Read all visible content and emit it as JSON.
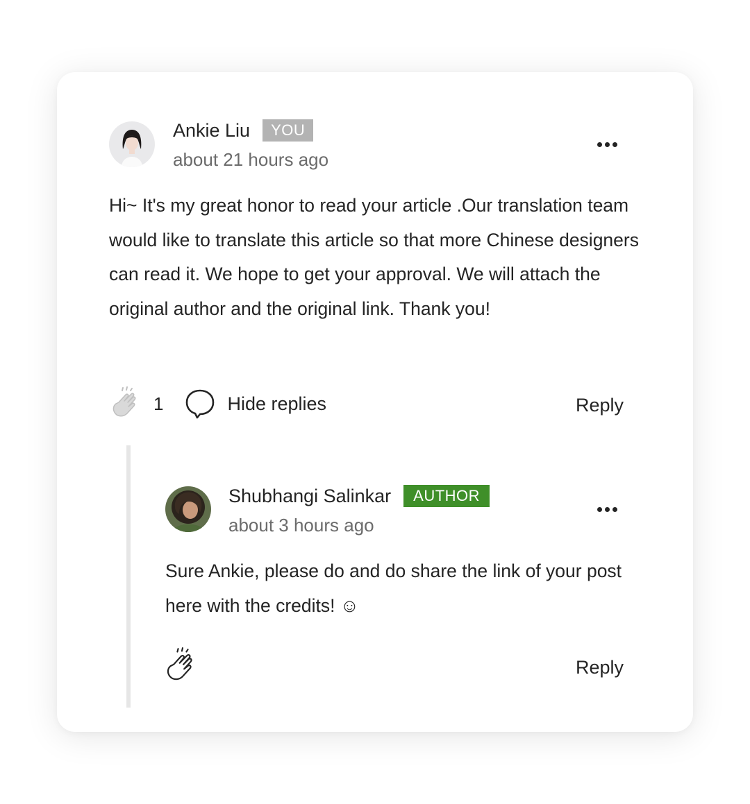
{
  "comments": [
    {
      "author": "Ankie Liu",
      "badge": "YOU",
      "timestamp": "about 21 hours ago",
      "avatar_icon": "person-avatar",
      "body": "Hi~ It's my great honor to read your article .Our translation team would like to translate this article so that more Chinese designers can read it. We hope to get your approval. We will attach the original author and the original link. Thank you!",
      "clap_count": "1",
      "hide_replies_label": "Hide replies",
      "reply_label": "Reply"
    }
  ],
  "replies": [
    {
      "author": "Shubhangi Salinkar",
      "badge": "AUTHOR",
      "timestamp": "about 3 hours ago",
      "avatar_icon": "person-avatar",
      "body": "Sure Ankie, please do and do share the link of your post here with the credits! ☺",
      "reply_label": "Reply"
    }
  ],
  "colors": {
    "you_badge": "#b3b3b3",
    "author_badge": "#3f8f29",
    "text": "#242424",
    "muted": "#6b6b6b"
  }
}
